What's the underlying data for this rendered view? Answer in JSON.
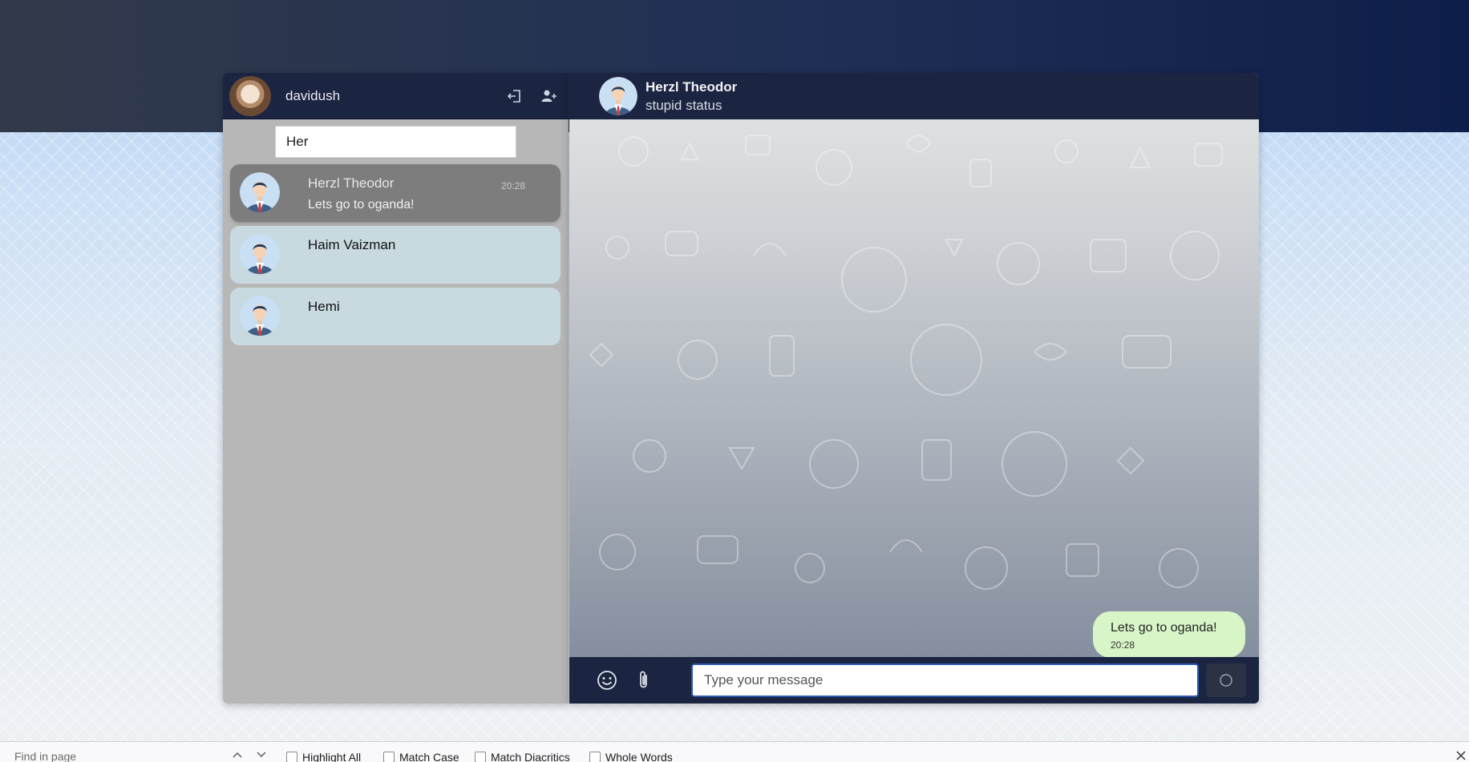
{
  "sidebar": {
    "username": "davidush",
    "search": {
      "value": "Her",
      "placeholder": ""
    },
    "chats": [
      {
        "name": "Herzl Theodor",
        "last_message": "Lets go to oganda!",
        "time": "20:28",
        "active": true
      },
      {
        "name": "Haim Vaizman",
        "last_message": "",
        "time": "",
        "active": false
      },
      {
        "name": "Hemi",
        "last_message": "",
        "time": "",
        "active": false
      }
    ],
    "icons": {
      "logout": "logout-icon",
      "add_contact": "add-user-icon"
    }
  },
  "conversation": {
    "contact_name": "Herzl Theodor",
    "contact_status": "stupid status",
    "messages": [
      {
        "text": "Lets go to oganda!",
        "time": "20:28",
        "outgoing": true
      }
    ],
    "input": {
      "placeholder": "Type your message",
      "value": ""
    },
    "icons": {
      "emoji": "emoji-icon",
      "attach": "paperclip-icon",
      "send": "send-icon"
    }
  },
  "findbar": {
    "placeholder": "Find in page",
    "options": [
      "Highlight All",
      "Match Case",
      "Match Diacritics",
      "Whole Words"
    ]
  },
  "colors": {
    "header_bg": "#1b2440",
    "sidebar_bg": "#b7b7b7",
    "chat_item_bg": "#c8dae0",
    "chat_item_active_bg": "#7d7d7d",
    "outgoing_bubble": "#d8f5c8",
    "input_focus_border": "#2d5ab0"
  }
}
